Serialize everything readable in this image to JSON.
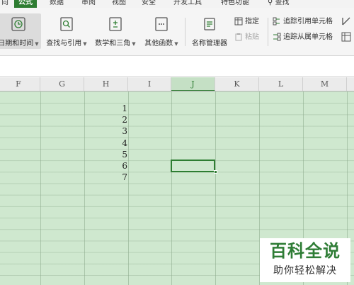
{
  "menu": {
    "tabs": [
      "向",
      "公式",
      "数据",
      "审阅",
      "视图",
      "安全",
      "开发工具",
      "特色功能"
    ],
    "active_tab": "公式",
    "search_label": "查找"
  },
  "ribbon": {
    "date_time": "日期和时间",
    "lookup": "查找与引用",
    "math": "数学和三角",
    "other_functions": "其他函数",
    "name_manager": "名称管理器",
    "specify": "指定",
    "paste": "粘贴",
    "trace_precedents": "追踪引用单元格",
    "trace_dependents": "追踪从属单元格"
  },
  "columns": [
    "F",
    "G",
    "H",
    "I",
    "J",
    "K",
    "L",
    "M"
  ],
  "active_column": "J",
  "cell_values": [
    "1",
    "2",
    "3",
    "4",
    "5",
    "6",
    "7"
  ],
  "colors": {
    "accent": "#2e7d32",
    "grid_bg": "#cfe8cf",
    "watermark_green": "#2f7d36"
  },
  "watermark": {
    "title": "百科全说",
    "subtitle": "助你轻松解决"
  }
}
